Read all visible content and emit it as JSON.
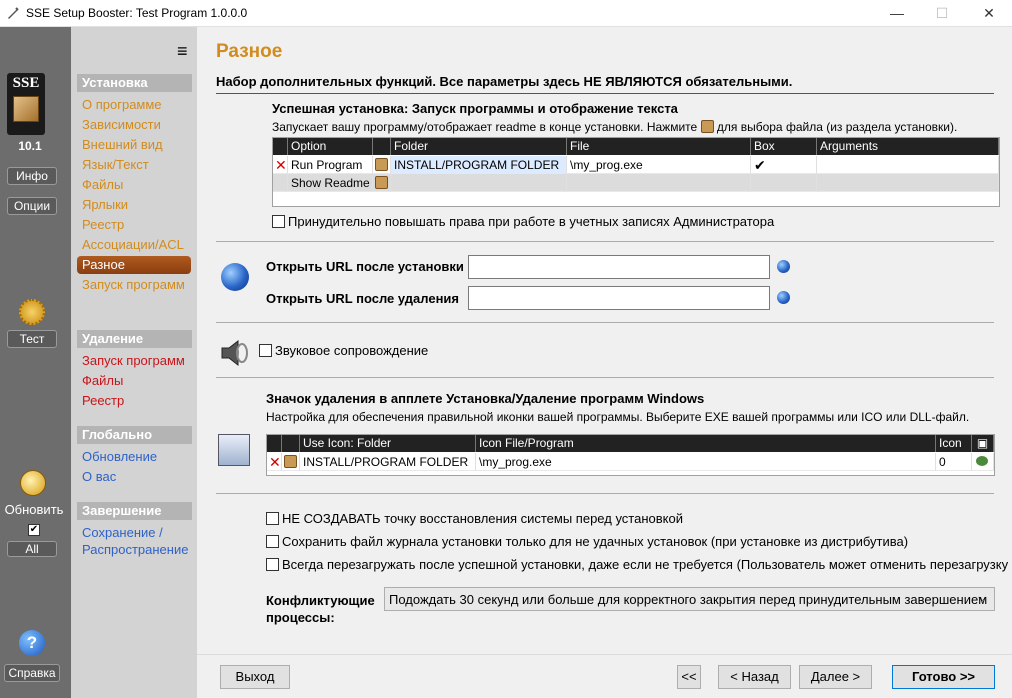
{
  "window": {
    "title": "SSE Setup Booster: Test Program 1.0.0.0",
    "min": "—",
    "max": "☐",
    "close": "✕"
  },
  "strip": {
    "logo_text": "SSE",
    "version": "10.1",
    "info": "Инфо",
    "options": "Опции",
    "test": "Тест",
    "update": "Обновить",
    "all": "All",
    "help": "Справка"
  },
  "nav": {
    "menu_icon": "≡",
    "sections": [
      {
        "title": "Установка",
        "items": [
          "О программе",
          "Зависимости",
          "Внешний вид",
          "Язык/Текст",
          "Файлы",
          "Ярлыки",
          "Реестр",
          "Ассоциации/ACL",
          "Разное",
          "Запуск программ"
        ],
        "selected": "Разное"
      },
      {
        "title": "Удаление",
        "items": [
          "Запуск программ",
          "Файлы",
          "Реестр"
        ]
      },
      {
        "title": "Глобально",
        "items": [
          "Обновление",
          "О вас"
        ]
      },
      {
        "title": "Завершение",
        "items": [
          "Сохранение /",
          "Распространение"
        ]
      }
    ]
  },
  "page": {
    "title": "Разное",
    "subtitle": "Набор дополнительных функций. Все параметры здесь НЕ ЯВЛЯЮТСЯ обязательными.",
    "run": {
      "heading": "Успешная установка: Запуск программы и отображение текста",
      "desc_a": "Запускает вашу программу/отображает readme в конце установки. Нажмите",
      "desc_b": "для выбора файла (из раздела установки).",
      "columns": [
        "Option",
        "Folder",
        "File",
        "Box Default",
        "Arguments"
      ],
      "rows": [
        {
          "option": "Run Program",
          "folder": "INSTALL/PROGRAM FOLDER",
          "file": "\\my_prog.exe",
          "box_default": "✔",
          "arguments": ""
        },
        {
          "option": "Show Readme",
          "folder": "",
          "file": "",
          "box_default": "",
          "arguments": ""
        }
      ],
      "elevate_label": "Принудительно повышать права при работе в учетных записях Администратора"
    },
    "url": {
      "after_install": "Открыть URL после установки",
      "after_uninstall": "Открыть URL после удаления",
      "install_value": "",
      "uninstall_value": ""
    },
    "sound_label": "Звуковое сопровождение",
    "icon": {
      "heading": "Значок удаления в апплете Установка/Удаление программ Windows",
      "desc": "Настройка для обеспечения правильной иконки вашей программы. Выберите EXE вашей программы или ICO или DLL-файл.",
      "columns": [
        "Use Icon: Folder",
        "Icon File/Program",
        "Icon #"
      ],
      "row": {
        "folder": "INSTALL/PROGRAM FOLDER",
        "file": "\\my_prog.exe",
        "index": "0"
      }
    },
    "options": [
      "НЕ СОЗДАВАТЬ точку восстановления системы перед установкой",
      "Сохранить файл журнала установки только для не удачных установок (при установке из дистрибутива)",
      "Всегда перезагружать после успешной установки, даже если не требуется (Пользователь может отменить перезагрузку"
    ],
    "conflict": {
      "label": "Конфликтующие процессы:",
      "value": "Подождать 30 секунд или больше для корректного закрытия перед принудительным завершением"
    },
    "buttons": {
      "exit": "Выход",
      "first": "<<",
      "back": "< Назад",
      "next": "Далее >",
      "done": "Готово >>"
    }
  }
}
